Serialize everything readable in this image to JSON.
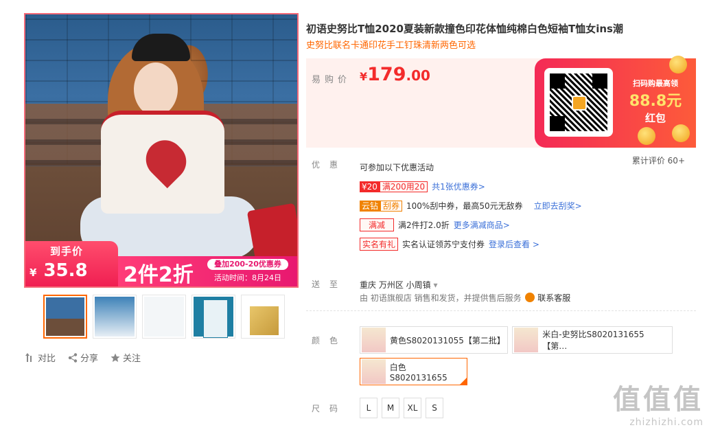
{
  "product": {
    "title": "初语史努比T恤2020夏装新款撞色印花体恤纯棉白色短袖T恤女ins潮",
    "subtitle": "史努比联名卡通印花手工钉珠清新两色可选"
  },
  "image_banner": {
    "tag": "到手价",
    "currency": "¥",
    "price": "35.8",
    "promo": "2件2折",
    "coupon": "叠加200-20优惠券",
    "time": "活动时间：8月24日"
  },
  "actions": {
    "compare": "对比",
    "share": "分享",
    "follow": "关注"
  },
  "price": {
    "label": "易购价",
    "currency": "¥",
    "integer": "179",
    "decimal": ".00"
  },
  "qr": {
    "line1": "扫码购最高领",
    "line2": "88.8元",
    "line3": "红包"
  },
  "rating": "累计评价 60+",
  "promo": {
    "label": "优惠",
    "intro": "可参加以下优惠活动",
    "coupon_amount": "¥20",
    "coupon_cond": "满200用20",
    "coupon_link": "共1张优惠券>",
    "yunzuan": "云钻",
    "guaquan": "刮券",
    "gua_desc": "100%刮中券，最高50元无敌券",
    "gua_link": "立即去刮奖>",
    "manjian": "满减",
    "manjian_desc": "满2件打2.0折",
    "manjian_link": "更多满减商品>",
    "shiming": "实名有礼",
    "shiming_desc": "实名认证领苏宁支付券",
    "shiming_link": "登录后查看 >"
  },
  "shipping": {
    "label": "送至",
    "location": "重庆 万州区 小周镇",
    "desc": "由 初语旗舰店 销售和发货，并提供售后服务",
    "service": "联系客服"
  },
  "color": {
    "label": "颜色",
    "options": [
      "黄色S8020131055【第二批】",
      "米白-史努比S8020131655【第…",
      "白色S8020131655"
    ]
  },
  "size": {
    "label": "尺码",
    "options": [
      "L",
      "M",
      "XL",
      "S"
    ]
  },
  "watermark": {
    "big": "值值值",
    "small": "zhizhizhi.com"
  }
}
